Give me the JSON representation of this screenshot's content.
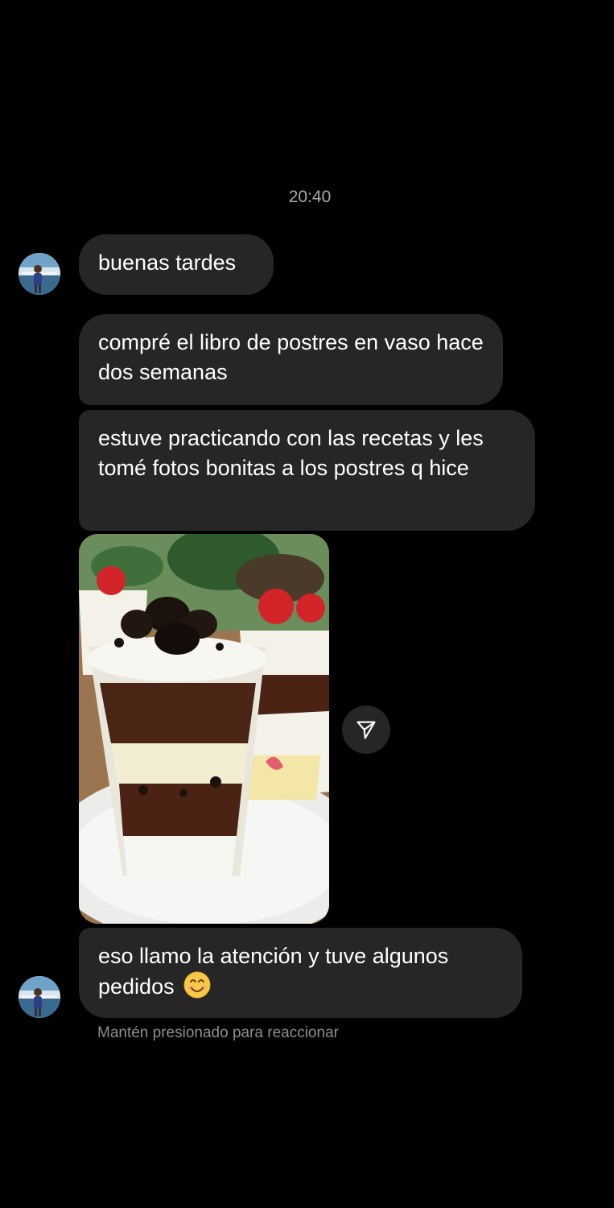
{
  "conversation": {
    "timestamp": "20:40",
    "messages": [
      {
        "text": "buenas tardes"
      },
      {
        "text": "compré el libro de postres en vaso hace dos semanas"
      },
      {
        "text": "estuve practicando con las recetas y les tomé fotos bonitas a los postres q hice"
      },
      {
        "text": "eso llamo la atención y tuve algunos pedidos"
      }
    ],
    "photo_icon": "paper-plane-icon",
    "emoji_icon": "smiling-face-icon",
    "hint": "Mantén presionado para reaccionar"
  },
  "colors": {
    "background": "#000000",
    "bubble": "#262626",
    "secondary_text": "#a8a8a8"
  }
}
